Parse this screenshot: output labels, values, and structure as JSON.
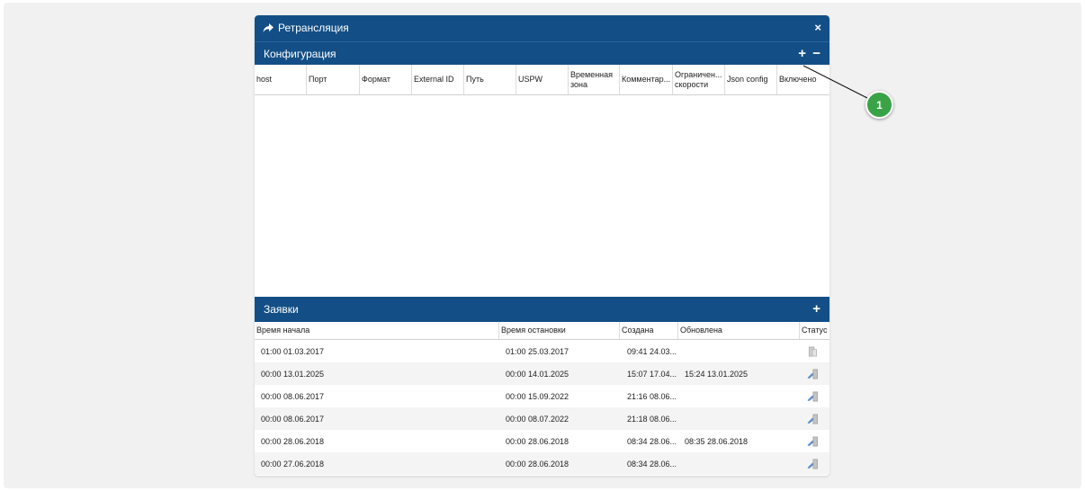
{
  "window": {
    "title": "Ретрансляция",
    "close_icon": "×"
  },
  "config": {
    "title": "Конфигурация",
    "add_label": "+",
    "remove_label": "−",
    "columns": [
      "host",
      "Порт",
      "Формат",
      "External ID",
      "Путь",
      "USPW",
      "Временная зона",
      "Комментар...",
      "Ограничен... скорости",
      "Json config",
      "Включено"
    ]
  },
  "requests": {
    "title": "Заявки",
    "add_label": "+",
    "columns": [
      "Время начала",
      "Время остановки",
      "Создана",
      "Обновлена",
      "Статус"
    ],
    "rows": [
      {
        "start": "01:00 01.03.2017",
        "stop": "01:00 25.03.2017",
        "created": "09:41 24.03...",
        "updated": "",
        "status": "inactive"
      },
      {
        "start": "00:00 13.01.2025",
        "stop": "00:00 14.01.2025",
        "created": "15:07 17.04...",
        "updated": "15:24 13.01.2025",
        "status": "active"
      },
      {
        "start": "00:00 08.06.2017",
        "stop": "00:00 15.09.2022",
        "created": "21:16 08.06...",
        "updated": "",
        "status": "active"
      },
      {
        "start": "00:00 08.06.2017",
        "stop": "00:00 08.07.2022",
        "created": "21:18 08.06...",
        "updated": "",
        "status": "active"
      },
      {
        "start": "00:00 28.06.2018",
        "stop": "00:00 28.06.2018",
        "created": "08:34 28.06...",
        "updated": "08:35 28.06.2018",
        "status": "active"
      },
      {
        "start": "00:00 27.06.2018",
        "stop": "00:00 28.06.2018",
        "created": "08:34 28.06...",
        "updated": "",
        "status": "active"
      }
    ]
  },
  "callout": {
    "number": "1"
  },
  "colors": {
    "header": "#134f86",
    "callout": "#3aa347"
  }
}
